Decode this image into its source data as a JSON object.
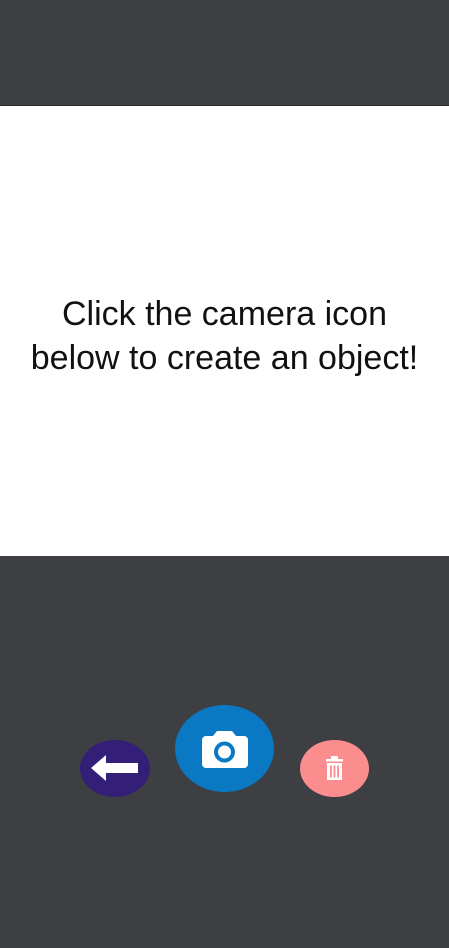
{
  "canvas": {
    "instruction_line1": "Click the camera icon",
    "instruction_line2": "below to create an object!"
  },
  "toolbar": {
    "back_icon": "arrow-left-icon",
    "camera_icon": "camera-icon",
    "delete_icon": "trash-icon"
  },
  "colors": {
    "background": "#3e3f43",
    "canvas": "#ffffff",
    "back_button": "#341f78",
    "camera_button": "#0a78c2",
    "delete_button": "#fb8d8f"
  }
}
